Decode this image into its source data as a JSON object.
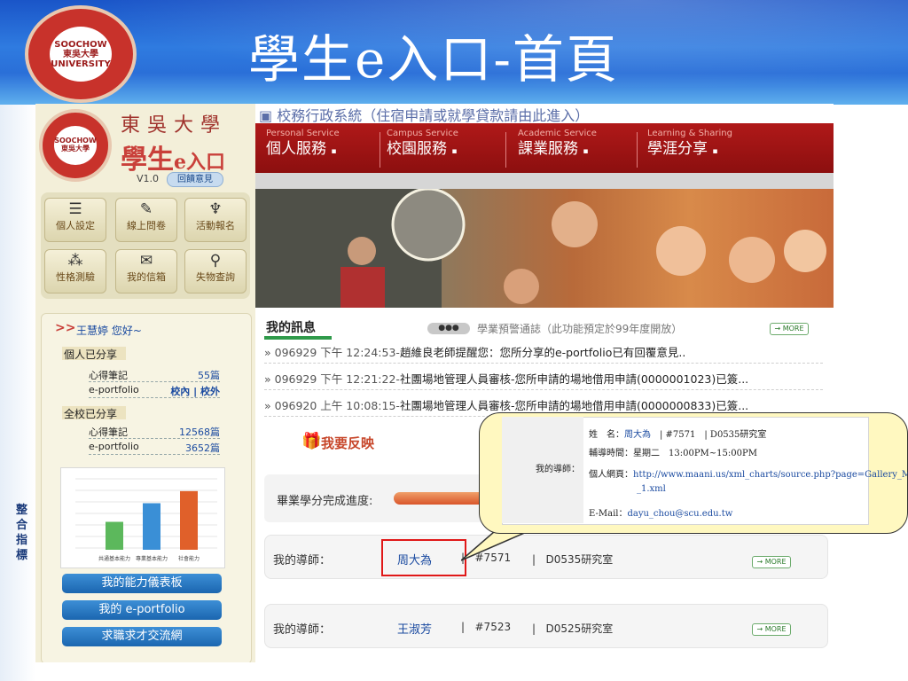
{
  "slide": {
    "title": "學生e入口-首頁",
    "side_label": "整合指標",
    "logo_alt": "東吳大學 校徽"
  },
  "site": {
    "school_name": "東吳大學",
    "portal_name": "學生",
    "portal_suffix": "e入口",
    "version": "V1.0",
    "feedback_button": "回饋意見",
    "tools": [
      {
        "label": "個人設定",
        "icon": "books-icon"
      },
      {
        "label": "線上問卷",
        "icon": "pen-icon"
      },
      {
        "label": "活動報名",
        "icon": "trophy-icon"
      },
      {
        "label": "性格測驗",
        "icon": "people-icon"
      },
      {
        "label": "我的信箱",
        "icon": "mail-icon"
      },
      {
        "label": "失物查詢",
        "icon": "magnifier-icon"
      }
    ],
    "greeting_arrow": ">>",
    "greeting": "王慧婷 您好~",
    "personal_share": {
      "label": "個人已分享",
      "notes_label": "心得筆記",
      "notes_count": "55篇",
      "eportfolio_label": "e-portfolio",
      "eportfolio_links": "校內 | 校外"
    },
    "school_share": {
      "label": "全校已分享",
      "notes_label": "心得筆記",
      "notes_count": "12568篇",
      "eportfolio_label": "e-portfolio",
      "eportfolio_count": "3652篇"
    },
    "buttons": [
      "我的能力儀表板",
      "我的 e-portfolio",
      "求職求才交流網"
    ],
    "top_link": "校務行政系統（住宿申請或就學貸款請由此進入）",
    "nav": [
      {
        "en": "Personal Service",
        "zh": "個人服務"
      },
      {
        "en": "Campus Service",
        "zh": "校園服務"
      },
      {
        "en": "Academic Service",
        "zh": "課業服務"
      },
      {
        "en": "Learning & Sharing",
        "zh": "學涯分享"
      }
    ],
    "messages": {
      "title": "我的訊息",
      "warning_tag": "●●●",
      "warning_text": "學業預警通誌（此功能預定於99年度開放）",
      "more": "→ MORE",
      "rows": [
        {
          "date": "» 096929 下午 12:24:53-",
          "text": "趙維良老師提醒您：您所分享的e-portfolio已有回覆意見.."
        },
        {
          "date": "» 096929 下午 12:21:22-",
          "text": "社團場地管理人員審核-您所申請的場地借用申請(0000001023)已簽..."
        },
        {
          "date": "» 096920 上午 10:08:15-",
          "text": "社團場地管理人員審核-您所申請的場地借用申請(0000000833)已簽..."
        }
      ]
    },
    "feedback_link": "我要反映",
    "progress": {
      "label": "畢業學分完成進度:",
      "fraction": 0.3
    },
    "advisors": [
      {
        "label": "我的導師：",
        "name": "周大為",
        "ext": "#7571",
        "room": "D0535研究室"
      },
      {
        "label": "我的導師：",
        "name": "王淑芳",
        "ext": "#7523",
        "room": "D0525研究室"
      }
    ],
    "chart": {
      "bars": [
        {
          "label": "共通基本能力",
          "value": 30
        },
        {
          "label": "專業基本能力",
          "value": 50
        },
        {
          "label": "社會能力",
          "value": 63
        }
      ]
    }
  },
  "callout": {
    "tutor_label": "我的導師：",
    "name_label": "姓　名：",
    "name": "周大為",
    "ext_room": "| #7571　| D0535研究室",
    "hours_label": "輔導時間：",
    "hours": "星期二　13:00PM~15:00PM",
    "web_label": "個人網頁：",
    "web_url": "http://www.maani.us/xml_charts/source.php?page=Gallery_Mixed",
    "web_url2": "_1.xml",
    "email_label": "E-Mail：",
    "email": "dayu_chou@scu.edu.tw"
  }
}
